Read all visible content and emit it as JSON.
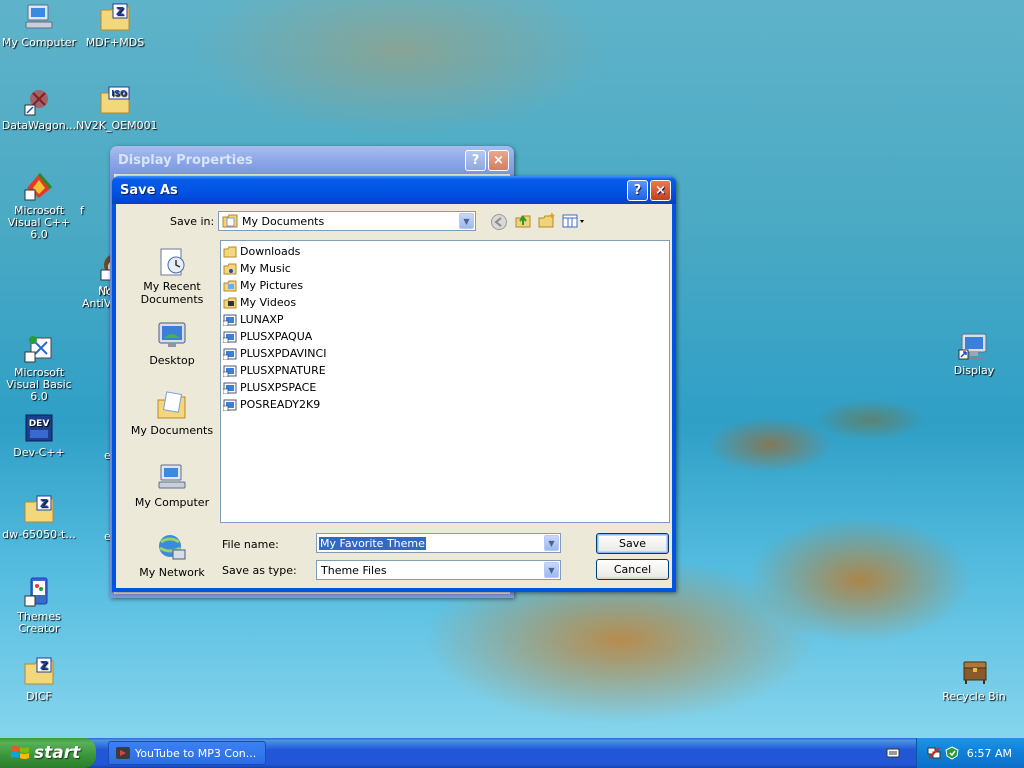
{
  "desktop": {
    "icons_left": [
      {
        "label": "My Computer",
        "icon": "my-computer-icon"
      },
      {
        "label": "MDF+MDS",
        "icon": "zip-folder-icon"
      },
      {
        "label": "DataWagon...",
        "icon": "shortcut-icon"
      },
      {
        "label": "NV2K_OEM001",
        "icon": "iso-file-icon"
      },
      {
        "label": "Microsoft Visual C++ 6.0",
        "icon": "visual-cpp-icon"
      },
      {
        "label": "Mypal",
        "icon": "mypal-browser-icon"
      },
      {
        "label": "Microsoft Visual Basic 6.0",
        "icon": "visual-basic-icon"
      },
      {
        "label": "Dev-C++",
        "icon": "dev-cpp-icon"
      },
      {
        "label": "dw-65050-t...",
        "icon": "zip-folder-icon"
      },
      {
        "label": "Themes Creator",
        "icon": "themes-creator-icon"
      },
      {
        "label": "DICF",
        "icon": "zip-folder-icon"
      }
    ],
    "icons_right": [
      {
        "label": "Display",
        "icon": "display-icon"
      },
      {
        "label": "Recycle Bin",
        "icon": "recycle-bin-icon"
      }
    ],
    "partial_labels": [
      "f",
      "No",
      "AntiVi",
      "e",
      "e"
    ]
  },
  "display_properties": {
    "title": "Display Properties"
  },
  "save_as": {
    "title": "Save As",
    "save_in_label": "Save in:",
    "save_in_value": "My Documents",
    "places": [
      {
        "label": "My Recent Documents",
        "icon": "recent-documents-icon"
      },
      {
        "label": "Desktop",
        "icon": "desktop-icon"
      },
      {
        "label": "My Documents",
        "icon": "my-documents-icon"
      },
      {
        "label": "My Computer",
        "icon": "my-computer-icon"
      },
      {
        "label": "My Network",
        "icon": "my-network-icon"
      }
    ],
    "files": [
      {
        "name": "Downloads",
        "icon": "folder-icon"
      },
      {
        "name": "My Music",
        "icon": "music-folder-icon"
      },
      {
        "name": "My Pictures",
        "icon": "pictures-folder-icon"
      },
      {
        "name": "My Videos",
        "icon": "videos-folder-icon"
      },
      {
        "name": "LUNAXP",
        "icon": "theme-file-icon"
      },
      {
        "name": "PLUSXPAQUA",
        "icon": "theme-file-icon"
      },
      {
        "name": "PLUSXPDAVINCI",
        "icon": "theme-file-icon"
      },
      {
        "name": "PLUSXPNATURE",
        "icon": "theme-file-icon"
      },
      {
        "name": "PLUSXPSPACE",
        "icon": "theme-file-icon"
      },
      {
        "name": "POSREADY2K9",
        "icon": "theme-file-icon"
      }
    ],
    "file_name_label": "File name:",
    "file_name_value": "My Favorite Theme",
    "save_as_type_label": "Save as type:",
    "save_as_type_value": "Theme Files",
    "save_button": "Save",
    "cancel_button": "Cancel",
    "help_glyph": "?",
    "close_glyph": "×"
  },
  "taskbar": {
    "start_label": "start",
    "task_label": "YouTube to MP3 Con...",
    "clock": "6:57 AM"
  }
}
